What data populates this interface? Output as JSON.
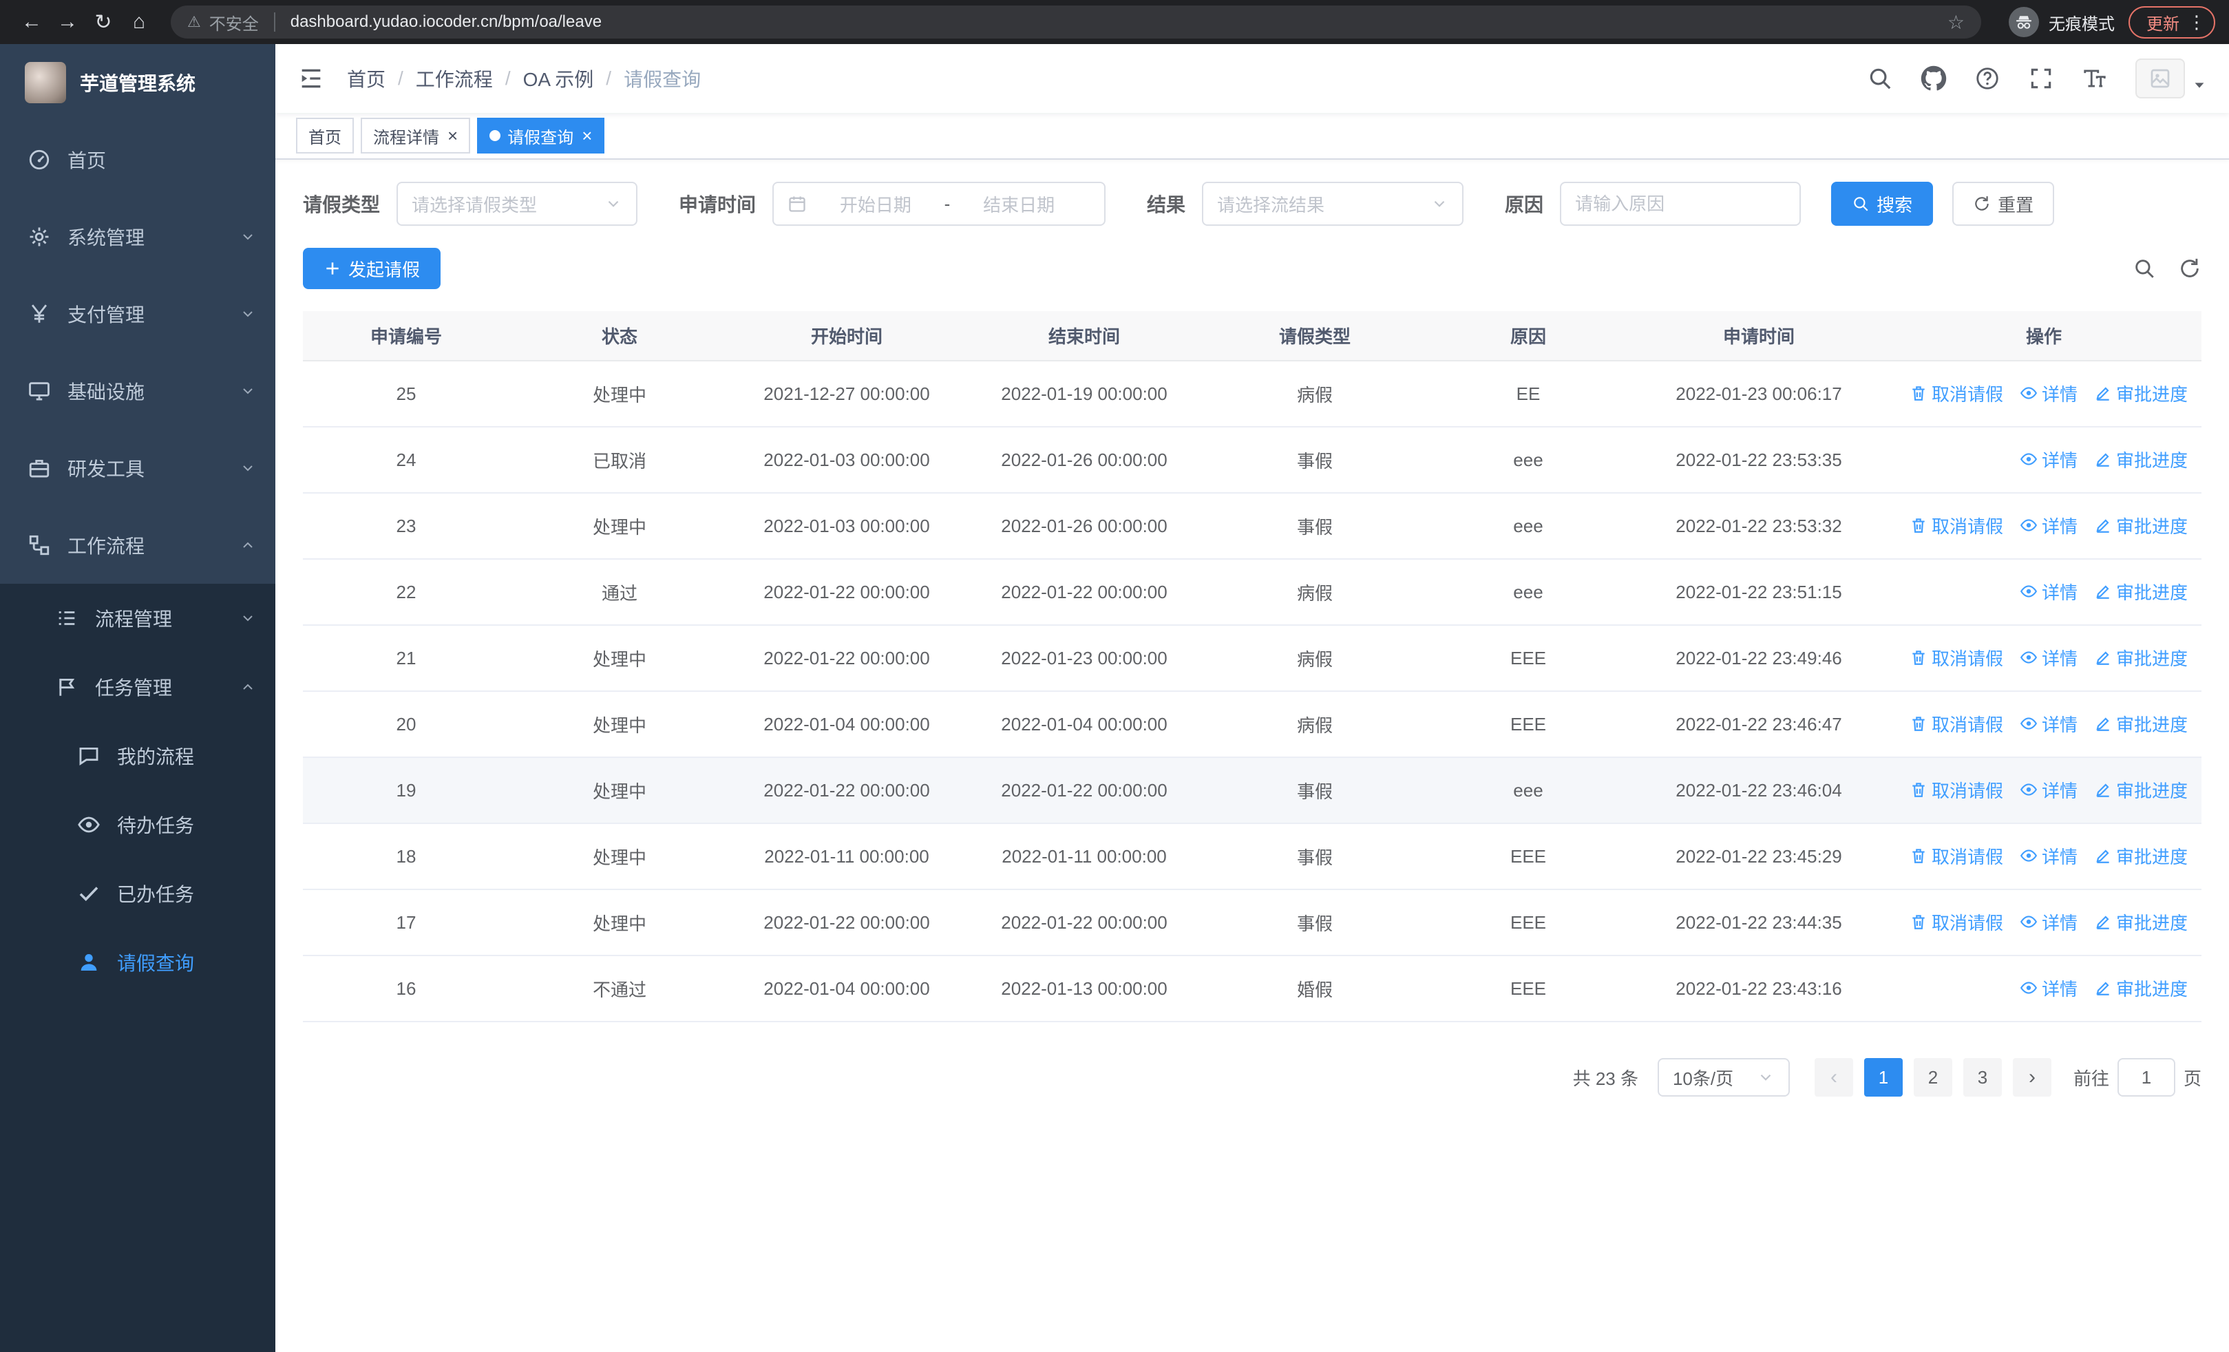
{
  "colors": {
    "primary": "#2d8cf0",
    "link": "#409eff",
    "sidebar_bg": "#304156",
    "submenu_bg": "#1f2d3d",
    "menu_text": "#bfcbd9",
    "chrome_bg": "#202124"
  },
  "icons": {
    "back": "←",
    "forward": "→",
    "reload": "↻",
    "home": "⌂",
    "warning": "⚠",
    "star": "☆",
    "menu_dots": "⋮",
    "close": "×"
  },
  "browser": {
    "security_warning": "不安全",
    "url": "dashboard.yudao.iocoder.cn/bpm/oa/leave",
    "incognito_label": "无痕模式",
    "update_button": "更新"
  },
  "sidebar": {
    "logo_title": "芋道管理系统",
    "menu": [
      {
        "key": "home",
        "label": "首页",
        "icon": "dashboard"
      },
      {
        "key": "system",
        "label": "系统管理",
        "icon": "gear",
        "arrow": "down"
      },
      {
        "key": "payment",
        "label": "支付管理",
        "icon": "yen",
        "arrow": "down"
      },
      {
        "key": "infrastructure",
        "label": "基础设施",
        "icon": "monitor",
        "arrow": "down"
      },
      {
        "key": "dev-tools",
        "label": "研发工具",
        "icon": "briefcase",
        "arrow": "down"
      },
      {
        "key": "workflow",
        "label": "工作流程",
        "icon": "flow",
        "arrow": "up",
        "open": true,
        "children": [
          {
            "key": "process-management",
            "label": "流程管理",
            "icon": "list",
            "arrow": "down"
          },
          {
            "key": "task-management",
            "label": "任务管理",
            "icon": "flag",
            "arrow": "up",
            "open": true,
            "children": [
              {
                "key": "my-process",
                "label": "我的流程",
                "icon": "chat"
              },
              {
                "key": "todo-task",
                "label": "待办任务",
                "icon": "eye"
              },
              {
                "key": "done-task",
                "label": "已办任务",
                "icon": "check"
              },
              {
                "key": "leave-query",
                "label": "请假查询",
                "icon": "user",
                "active": true
              }
            ]
          }
        ]
      }
    ]
  },
  "header": {
    "breadcrumb": [
      "首页",
      "工作流程",
      "OA 示例",
      "请假查询"
    ],
    "right_icons": [
      "search",
      "github",
      "help",
      "fullscreen",
      "font-size"
    ]
  },
  "tabs": [
    {
      "label": "首页",
      "closable": false,
      "active": false
    },
    {
      "label": "流程详情",
      "closable": true,
      "active": false
    },
    {
      "label": "请假查询",
      "closable": true,
      "active": true
    }
  ],
  "filters": {
    "leave_type_label": "请假类型",
    "leave_type_placeholder": "请选择请假类型",
    "apply_time_label": "申请时间",
    "date_start_placeholder": "开始日期",
    "date_separator": "-",
    "date_end_placeholder": "结束日期",
    "result_label": "结果",
    "result_placeholder": "请选择流结果",
    "reason_label": "原因",
    "reason_placeholder": "请输入原因",
    "search_button": "搜索",
    "reset_button": "重置"
  },
  "toolbar": {
    "create_button": "发起请假"
  },
  "table": {
    "columns": [
      "申请编号",
      "状态",
      "开始时间",
      "结束时间",
      "请假类型",
      "原因",
      "申请时间",
      "操作"
    ],
    "action_labels": {
      "cancel": "取消请假",
      "detail": "详情",
      "progress": "审批进度"
    },
    "rows": [
      {
        "id": "25",
        "status": "处理中",
        "start": "2021-12-27 00:00:00",
        "end": "2022-01-19 00:00:00",
        "type": "病假",
        "reason": "EE",
        "apply": "2022-01-23 00:06:17",
        "cancelable": true,
        "hover": false
      },
      {
        "id": "24",
        "status": "已取消",
        "start": "2022-01-03 00:00:00",
        "end": "2022-01-26 00:00:00",
        "type": "事假",
        "reason": "eee",
        "apply": "2022-01-22 23:53:35",
        "cancelable": false,
        "hover": false
      },
      {
        "id": "23",
        "status": "处理中",
        "start": "2022-01-03 00:00:00",
        "end": "2022-01-26 00:00:00",
        "type": "事假",
        "reason": "eee",
        "apply": "2022-01-22 23:53:32",
        "cancelable": true,
        "hover": false
      },
      {
        "id": "22",
        "status": "通过",
        "start": "2022-01-22 00:00:00",
        "end": "2022-01-22 00:00:00",
        "type": "病假",
        "reason": "eee",
        "apply": "2022-01-22 23:51:15",
        "cancelable": false,
        "hover": false
      },
      {
        "id": "21",
        "status": "处理中",
        "start": "2022-01-22 00:00:00",
        "end": "2022-01-23 00:00:00",
        "type": "病假",
        "reason": "EEE",
        "apply": "2022-01-22 23:49:46",
        "cancelable": true,
        "hover": false
      },
      {
        "id": "20",
        "status": "处理中",
        "start": "2022-01-04 00:00:00",
        "end": "2022-01-04 00:00:00",
        "type": "病假",
        "reason": "EEE",
        "apply": "2022-01-22 23:46:47",
        "cancelable": true,
        "hover": false
      },
      {
        "id": "19",
        "status": "处理中",
        "start": "2022-01-22 00:00:00",
        "end": "2022-01-22 00:00:00",
        "type": "事假",
        "reason": "eee",
        "apply": "2022-01-22 23:46:04",
        "cancelable": true,
        "hover": true
      },
      {
        "id": "18",
        "status": "处理中",
        "start": "2022-01-11 00:00:00",
        "end": "2022-01-11 00:00:00",
        "type": "事假",
        "reason": "EEE",
        "apply": "2022-01-22 23:45:29",
        "cancelable": true,
        "hover": false
      },
      {
        "id": "17",
        "status": "处理中",
        "start": "2022-01-22 00:00:00",
        "end": "2022-01-22 00:00:00",
        "type": "事假",
        "reason": "EEE",
        "apply": "2022-01-22 23:44:35",
        "cancelable": true,
        "hover": false
      },
      {
        "id": "16",
        "status": "不通过",
        "start": "2022-01-04 00:00:00",
        "end": "2022-01-13 00:00:00",
        "type": "婚假",
        "reason": "EEE",
        "apply": "2022-01-22 23:43:16",
        "cancelable": false,
        "hover": false
      }
    ]
  },
  "pagination": {
    "total_text": "共 23 条",
    "page_size": "10条/页",
    "prev": "‹",
    "next": "›",
    "pages": [
      "1",
      "2",
      "3"
    ],
    "active_page": "1",
    "goto_label": "前往",
    "goto_value": "1",
    "goto_unit": "页"
  }
}
